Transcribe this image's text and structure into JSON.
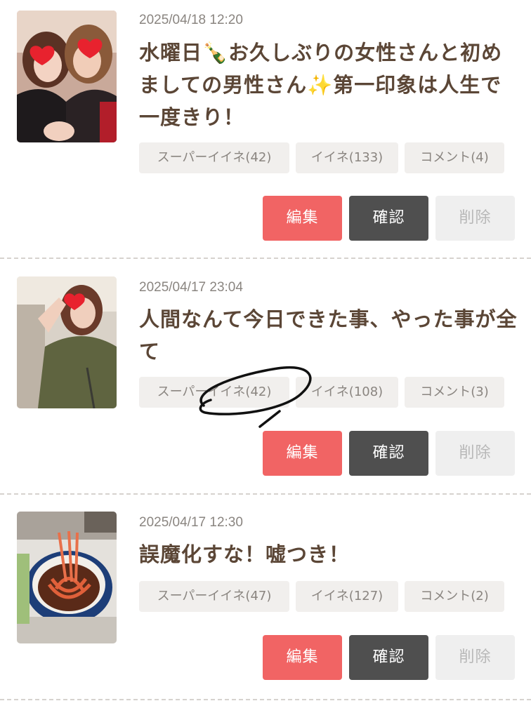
{
  "posts": [
    {
      "date": "2025/04/18 12:20",
      "title": "水曜日🍾お久しぶりの女性さんと初めましての男性さん✨第一印象は人生で一度きり！",
      "super_like": "スーパーイイネ(42)",
      "like": "イイネ(133)",
      "comment": "コメント(4)",
      "thumb_icon": "photo-two-women-heart-stickers"
    },
    {
      "date": "2025/04/17 23:04",
      "title": "人間なんて今日できた事、やった事が全て",
      "super_like": "スーパーイイネ(42)",
      "like": "イイネ(108)",
      "comment": "コメント(3)",
      "thumb_icon": "photo-woman-green-dress-heart-sticker"
    },
    {
      "date": "2025/04/17 12:30",
      "title": "誤魔化すな！嘘つき！",
      "super_like": "スーパーイイネ(47)",
      "like": "イイネ(127)",
      "comment": "コメント(2)",
      "thumb_icon": "photo-noodle-bowl"
    }
  ],
  "buttons": {
    "edit": "編集",
    "confirm": "確認",
    "delete": "削除"
  },
  "colors": {
    "edit": "#f16464",
    "confirm": "#4f4f4f",
    "delete_bg": "#efefef",
    "title": "#5b4636",
    "tag_bg": "#f1efed"
  }
}
